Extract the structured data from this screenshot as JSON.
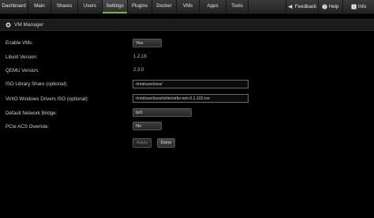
{
  "nav": {
    "tabs": [
      "Dashboard",
      "Main",
      "Shares",
      "Users",
      "Settings",
      "Plugins",
      "Docker",
      "VMs",
      "Apps",
      "Tools"
    ],
    "active_tab": "Settings",
    "right": {
      "feedback": "Feedback",
      "help": "Help",
      "info": "Info"
    }
  },
  "section": {
    "title": "VM Manager"
  },
  "fields": {
    "enable_vms": {
      "label": "Enable VMs:",
      "value": "Yes"
    },
    "libvirt_version": {
      "label": "Libvirt Version:",
      "value": "1.2.18"
    },
    "qemu_version": {
      "label": "QEMU Version:",
      "value": "2.3.0"
    },
    "iso_share": {
      "label": "ISO Library Share (optional):",
      "value": "/mnt/user/isos/"
    },
    "virtio_iso": {
      "label": "VirtIO Windows Drivers ISO (optional):",
      "value": "/mnt/user/isos/virtio/virtio-win-0.1.102.iso"
    },
    "network_bridge": {
      "label": "Default Network Bridge:",
      "value": "br0"
    },
    "pcie_acs": {
      "label": "PCIe ACS Override:",
      "value": "No"
    }
  },
  "buttons": {
    "apply": "Apply",
    "done": "Done"
  },
  "colors": {
    "accent": "#6abf1e",
    "background": "#000000"
  }
}
